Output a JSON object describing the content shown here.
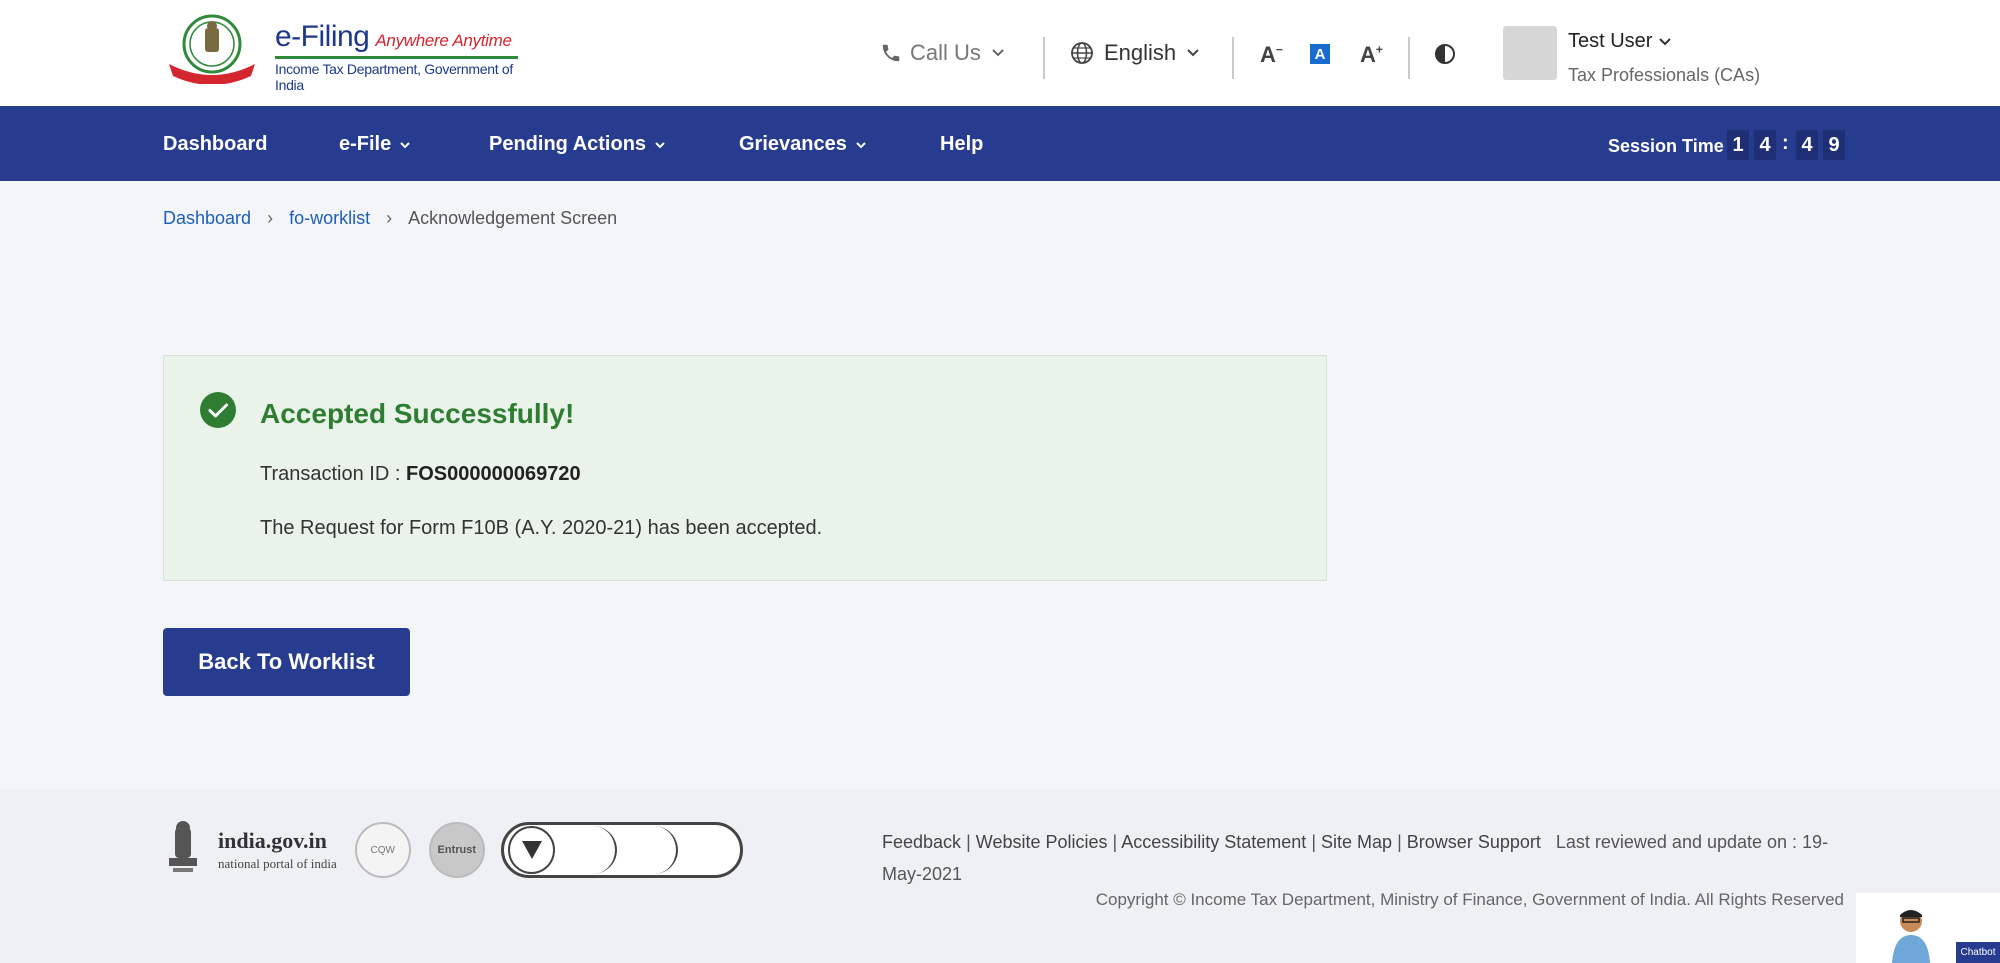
{
  "logo": {
    "title": "e-Filing",
    "tagline": "Anywhere Anytime",
    "subtitle": "Income Tax Department, Government of India"
  },
  "header": {
    "call_us": "Call Us",
    "language": "English",
    "font_decrease": "A",
    "font_normal": "A",
    "font_increase": "A",
    "user_name": "Test User",
    "user_role": "Tax Professionals (CAs)"
  },
  "nav": {
    "items": [
      {
        "label": "Dashboard"
      },
      {
        "label": "e-File"
      },
      {
        "label": "Pending Actions"
      },
      {
        "label": "Grievances"
      },
      {
        "label": "Help"
      }
    ],
    "session_label": "Session Time",
    "session_digits": [
      "1",
      "4",
      "4",
      "9"
    ],
    "session_colon": ":"
  },
  "breadcrumb": {
    "items": [
      "Dashboard",
      "fo-worklist"
    ],
    "current": "Acknowledgement Screen",
    "sep": "›"
  },
  "result": {
    "title": "Accepted Successfully!",
    "txn_label": "Transaction ID : ",
    "txn_id": "FOS000000069720",
    "message": "The Request for Form F10B (A.Y. 2020-21) has been accepted."
  },
  "actions": {
    "back_label": "Back To Worklist"
  },
  "footer": {
    "gov_title": "india.gov.in",
    "gov_sub": "national portal of india",
    "badge_cqw": "CQW",
    "badge_entrust": "Entrust",
    "links": [
      "Feedback",
      "Website Policies",
      "Accessibility Statement",
      "Site Map",
      "Browser Support"
    ],
    "link_sep": "|",
    "last_reviewed": "Last reviewed and update on : 19-May-2021",
    "copyright": "Copyright © Income Tax Department, Ministry of Finance, Government of India. All Rights Reserved"
  },
  "chatbot": {
    "label": "Chatbot"
  },
  "colors": {
    "primary": "#283c8f",
    "success": "#2e7d32",
    "link": "#1d5fb8"
  }
}
